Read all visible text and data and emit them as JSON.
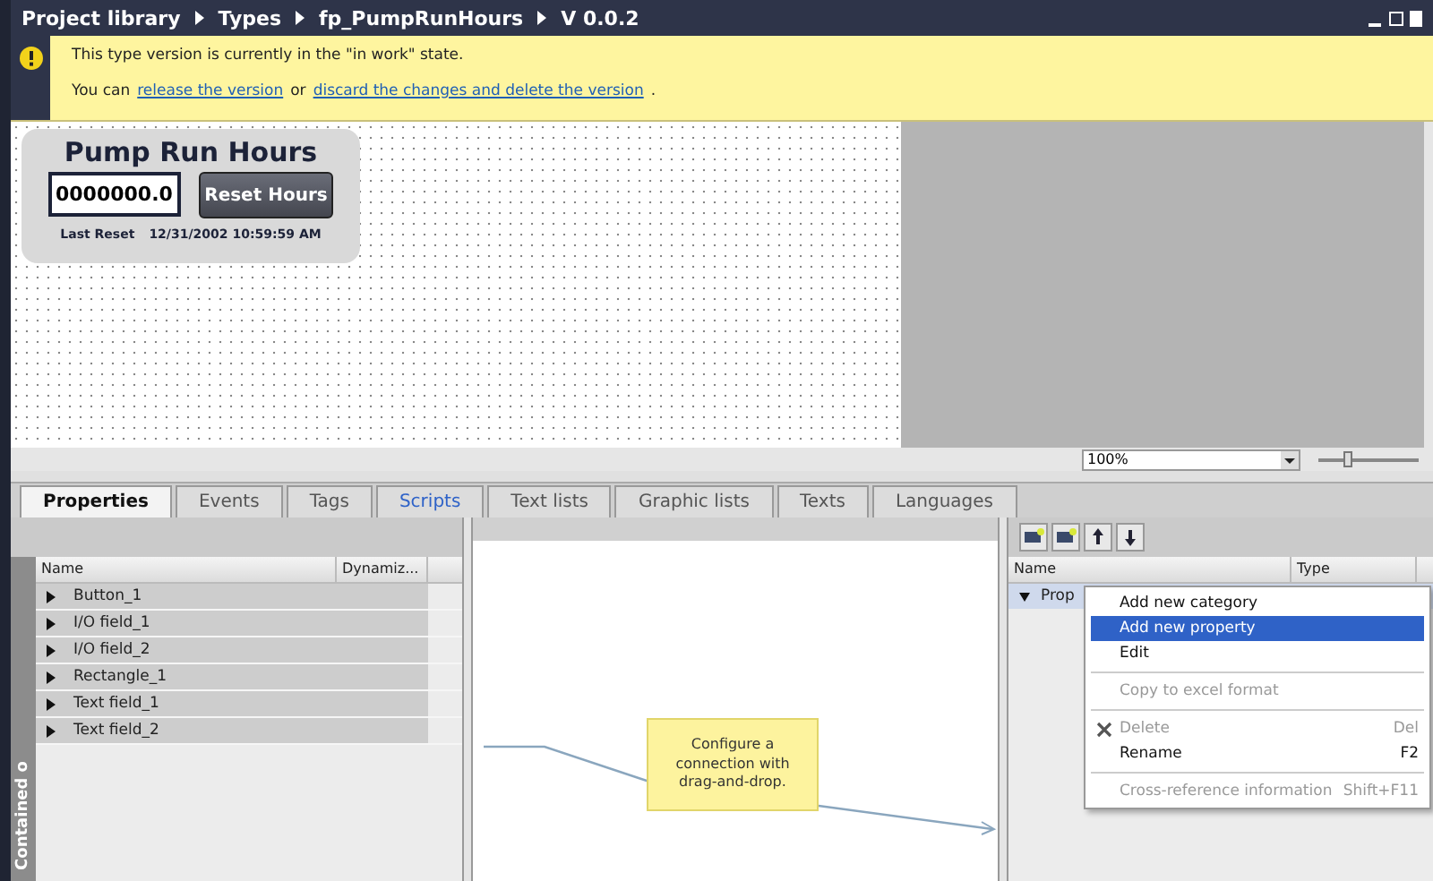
{
  "breadcrumb": [
    "Project library",
    "Types",
    "fp_PumpRunHours",
    "V 0.0.2"
  ],
  "banner": {
    "message": "This type version is currently in the \"in work\" state.",
    "prefix": "You can",
    "link_1": "release the version",
    "joiner": "or",
    "link_2": "discard the changes and delete the version",
    "suffix": "."
  },
  "faceplate": {
    "title": "Pump Run Hours",
    "value": "0000000.0",
    "button": "Reset Hours",
    "reset_label": "Last Reset",
    "reset_time": "12/31/2002 10:59:59 AM"
  },
  "zoom": {
    "value": "100%",
    "level": 0.3
  },
  "tabs": [
    {
      "label": "Properties",
      "selected": true,
      "highlighted": false
    },
    {
      "label": "Events",
      "selected": false,
      "highlighted": false
    },
    {
      "label": "Tags",
      "selected": false,
      "highlighted": false
    },
    {
      "label": "Scripts",
      "selected": false,
      "highlighted": true
    },
    {
      "label": "Text lists",
      "selected": false,
      "highlighted": false
    },
    {
      "label": "Graphic lists",
      "selected": false,
      "highlighted": false
    },
    {
      "label": "Texts",
      "selected": false,
      "highlighted": false
    },
    {
      "label": "Languages",
      "selected": false,
      "highlighted": false
    }
  ],
  "objects_pane": {
    "side_tab": "Contained o",
    "columns": [
      "Name",
      "Dynamiz..."
    ],
    "rows": [
      "Button_1",
      "I/O field_1",
      "I/O field_2",
      "Rectangle_1",
      "Text field_1",
      "Text field_2"
    ]
  },
  "hint": "Configure a connection with drag-and-drop.",
  "properties_pane": {
    "columns": [
      "Name",
      "Type"
    ],
    "rows": [
      {
        "name": "Prop",
        "expanded": true
      }
    ]
  },
  "context_menu": [
    {
      "kind": "item",
      "label": "Add new category",
      "selected": false,
      "disabled": false
    },
    {
      "kind": "item",
      "label": "Add new property",
      "selected": true,
      "disabled": false
    },
    {
      "kind": "item",
      "label": "Edit",
      "selected": false,
      "disabled": false
    },
    {
      "kind": "separator"
    },
    {
      "kind": "item",
      "label": "Copy to excel format",
      "selected": false,
      "disabled": true
    },
    {
      "kind": "separator"
    },
    {
      "kind": "icon_item",
      "label": "Delete",
      "shortcut": "Del",
      "selected": false,
      "disabled": true
    },
    {
      "kind": "item",
      "label": "Rename",
      "shortcut": "F2",
      "selected": false,
      "disabled": false
    },
    {
      "kind": "separator"
    },
    {
      "kind": "item",
      "label": "Cross-reference information",
      "shortcut": "Shift+F11",
      "selected": false,
      "disabled": true
    }
  ]
}
